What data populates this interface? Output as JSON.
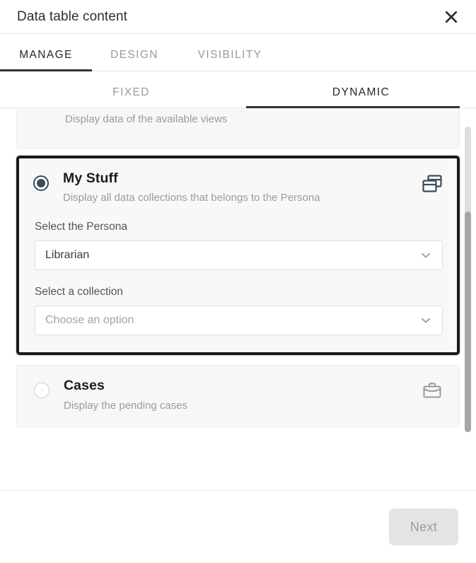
{
  "dialog": {
    "title": "Data table content",
    "close_icon": "close-icon"
  },
  "tabs_main": [
    {
      "label": "MANAGE",
      "active": true
    },
    {
      "label": "DESIGN",
      "active": false
    },
    {
      "label": "VISIBILITY",
      "active": false
    }
  ],
  "tabs_sub": [
    {
      "label": "FIXED",
      "active": false
    },
    {
      "label": "DYNAMIC",
      "active": true
    }
  ],
  "options": {
    "clipped_card": {
      "description": "Display data of the available views"
    },
    "my_stuff": {
      "name": "My Stuff",
      "description": "Display all data collections that belongs to the Persona",
      "icon": "collections-stack-icon",
      "selected": true,
      "fields": [
        {
          "label": "Select the Persona",
          "value": "Librarian",
          "is_placeholder": false,
          "chevron_icon": "chevron-down-icon"
        },
        {
          "label": "Select a collection",
          "value": "Choose an option",
          "is_placeholder": true,
          "chevron_icon": "chevron-down-icon"
        }
      ]
    },
    "cases": {
      "name": "Cases",
      "description": "Display the pending cases",
      "icon": "briefcase-icon",
      "selected": false
    }
  },
  "footer": {
    "next_label": "Next"
  },
  "colors": {
    "selected_border": "#1a1a1a",
    "radio_accent": "#3c4a5c",
    "tab_underline": "#333333",
    "disabled_button_bg": "#e4e4e4"
  }
}
